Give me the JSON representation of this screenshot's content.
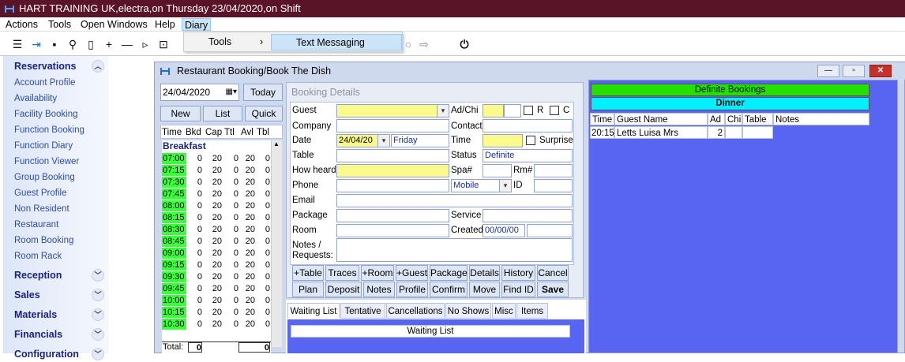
{
  "app": {
    "title": "HART TRAINING UK,electra,on Thursday 23/04/2020,on Shift"
  },
  "menu": {
    "items": [
      "Actions",
      "Tools",
      "Open Windows",
      "Help",
      "Diary"
    ]
  },
  "dropdown": {
    "item": "Tools",
    "arrow": "›",
    "submenu": "Text Messaging"
  },
  "sidebar": {
    "sections": [
      {
        "label": "Reservations",
        "items": [
          "Account Profile",
          "Availability",
          "Facility Booking",
          "Function Booking",
          "Function Diary",
          "Function Viewer",
          "Group Booking",
          "Guest Profile",
          "Non Resident",
          "Restaurant",
          "Room Booking",
          "Room Rack"
        ]
      },
      {
        "label": "Reception"
      },
      {
        "label": "Sales"
      },
      {
        "label": "Materials"
      },
      {
        "label": "Financials"
      },
      {
        "label": "Configuration"
      }
    ]
  },
  "window": {
    "title": "Restaurant Booking/Book The Dish"
  },
  "left_panel": {
    "date": "24/04/2020",
    "today": "Today",
    "new": "New",
    "list": "List",
    "quick": "Quick",
    "headers": [
      "Time",
      "Bkd",
      "Cap",
      "Ttl",
      "Avl",
      "Tbl"
    ],
    "meal": "Breakfast",
    "rows": [
      {
        "t": "07:00",
        "b": "0",
        "c": "20",
        "tt": "0",
        "a": "20",
        "tb": "0"
      },
      {
        "t": "07:15",
        "b": "0",
        "c": "20",
        "tt": "0",
        "a": "20",
        "tb": "0"
      },
      {
        "t": "07:30",
        "b": "0",
        "c": "20",
        "tt": "0",
        "a": "20",
        "tb": "0"
      },
      {
        "t": "07:45",
        "b": "0",
        "c": "20",
        "tt": "0",
        "a": "20",
        "tb": "0"
      },
      {
        "t": "08:00",
        "b": "0",
        "c": "20",
        "tt": "0",
        "a": "20",
        "tb": "0"
      },
      {
        "t": "08:15",
        "b": "0",
        "c": "20",
        "tt": "0",
        "a": "20",
        "tb": "0"
      },
      {
        "t": "08:30",
        "b": "0",
        "c": "20",
        "tt": "0",
        "a": "20",
        "tb": "0"
      },
      {
        "t": "08:45",
        "b": "0",
        "c": "20",
        "tt": "0",
        "a": "20",
        "tb": "0"
      },
      {
        "t": "09:00",
        "b": "0",
        "c": "20",
        "tt": "0",
        "a": "20",
        "tb": "0"
      },
      {
        "t": "09:15",
        "b": "0",
        "c": "20",
        "tt": "0",
        "a": "20",
        "tb": "0"
      },
      {
        "t": "09:30",
        "b": "0",
        "c": "20",
        "tt": "0",
        "a": "20",
        "tb": "0"
      },
      {
        "t": "09:45",
        "b": "0",
        "c": "20",
        "tt": "0",
        "a": "20",
        "tb": "0"
      },
      {
        "t": "10:00",
        "b": "0",
        "c": "20",
        "tt": "0",
        "a": "20",
        "tb": "0"
      },
      {
        "t": "10:15",
        "b": "0",
        "c": "20",
        "tt": "0",
        "a": "20",
        "tb": "0"
      },
      {
        "t": "10:30",
        "b": "0",
        "c": "20",
        "tt": "0",
        "a": "20",
        "tb": "0"
      }
    ],
    "total_label": "Total:",
    "total_bkd": "0",
    "total_avl": "0"
  },
  "booking": {
    "header": "Booking Details",
    "labels": {
      "guest": "Guest",
      "adchi": "Ad/Chi",
      "r": "R",
      "c": "C",
      "company": "Company",
      "contact": "Contact",
      "date": "Date",
      "time": "Time",
      "surprise": "Surprise",
      "table": "Table",
      "status": "Status",
      "howheard": "How heard",
      "spa": "Spa#",
      "rm": "Rm#",
      "phone": "Phone",
      "id": "ID",
      "email": "Email",
      "package": "Package",
      "service": "Service",
      "room": "Room",
      "created": "Created",
      "notes1": "Notes /",
      "notes2": "Requests:"
    },
    "values": {
      "date": "24/04/20",
      "day": "Friday",
      "status": "Definite",
      "phone_type": "Mobile",
      "created": "00/00/00"
    },
    "buttons_row1": [
      "+Table",
      "Traces",
      "+Room",
      "+Guest",
      "Package",
      "Details",
      "History",
      "Cancel"
    ],
    "buttons_row2": [
      "Plan",
      "Deposit",
      "Notes",
      "Profile",
      "Confirm",
      "Move",
      "Find ID",
      "Save"
    ]
  },
  "tabs": [
    "Waiting List",
    "Tentative",
    "Cancellations",
    "No Shows",
    "Misc",
    "Items"
  ],
  "waiting_list": {
    "header": "Waiting List"
  },
  "definite": {
    "header": "Definite Bookings",
    "meal": "Dinner",
    "columns": [
      "Time",
      "Guest Name",
      "Ad",
      "Chi",
      "Table",
      "Notes"
    ],
    "rows": [
      {
        "time": "20:15",
        "guest": "Letts Luisa Mrs",
        "ad": "2",
        "chi": "",
        "table": "",
        "notes": ""
      }
    ]
  },
  "colors": {
    "titlebar": "#5a1428",
    "green": "#3cff3c",
    "cyan": "#00f0ff",
    "bright_green": "#22e000",
    "blue_panel": "#5865f2",
    "yellow": "#fdfa8c"
  }
}
